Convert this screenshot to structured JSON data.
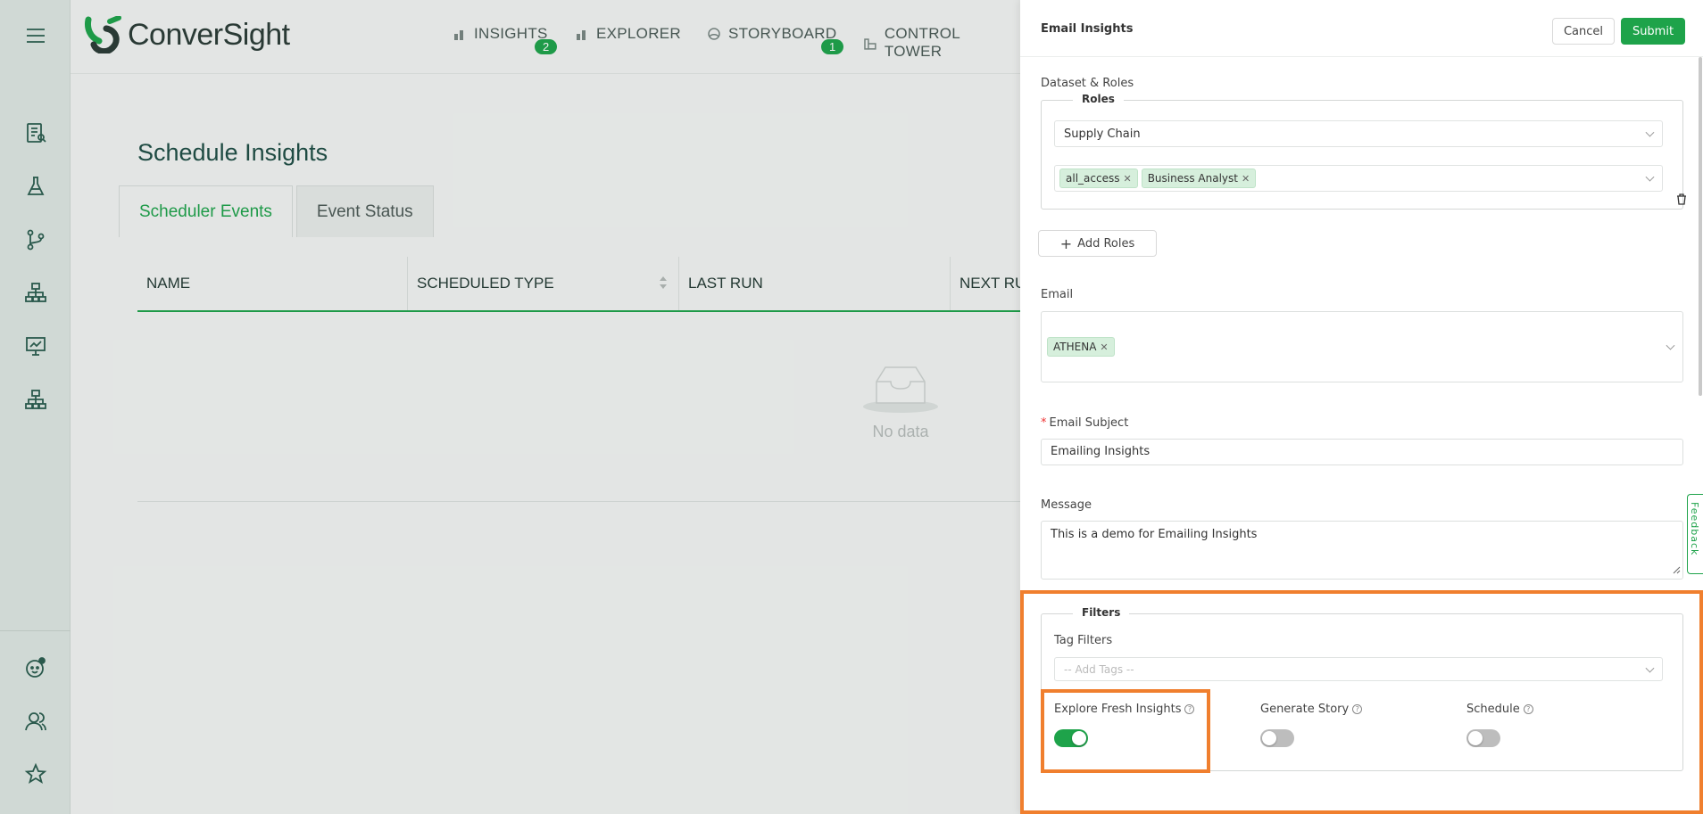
{
  "app": {
    "brand": "ConverSight"
  },
  "nav": {
    "items": [
      {
        "label": "INSIGHTS",
        "badge": "2"
      },
      {
        "label": "EXPLORER"
      },
      {
        "label": "STORYBOARD",
        "badge": "1"
      },
      {
        "label": "CONTROL TOWER"
      }
    ]
  },
  "rail": {
    "icons": [
      "menu-icon",
      "report-icon",
      "flask-icon",
      "branch-icon",
      "hierarchy-icon",
      "presentation-chart-icon",
      "org-chart-icon",
      "bot-icon",
      "users-icon",
      "star-icon"
    ]
  },
  "page": {
    "title": "Schedule Insights",
    "tabs": [
      "Scheduler Events",
      "Event Status"
    ],
    "columns": [
      "NAME",
      "SCHEDULED TYPE",
      "LAST RUN",
      "NEXT RU"
    ],
    "empty_text": "No data"
  },
  "drawer": {
    "title": "Email Insights",
    "cancel_label": "Cancel",
    "submit_label": "Submit",
    "dataset_roles_label": "Dataset & Roles",
    "roles_legend": "Roles",
    "dataset_value": "Supply Chain",
    "role_tags": [
      "all_access",
      "Business Analyst"
    ],
    "add_roles_label": "Add Roles",
    "email_label": "Email",
    "email_tags": [
      "ATHENA"
    ],
    "subject_label": "Email Subject",
    "subject_value": "Emailing Insights",
    "message_label": "Message",
    "message_value": "This is a demo for Emailing Insights",
    "filters_legend": "Filters",
    "tag_filters_label": "Tag Filters",
    "tag_filters_placeholder": "-- Add Tags --",
    "toggles": [
      {
        "label": "Explore Fresh Insights",
        "on": true
      },
      {
        "label": "Generate Story",
        "on": false
      },
      {
        "label": "Schedule",
        "on": false
      }
    ],
    "feedback_label": "Feedback"
  },
  "colors": {
    "accent": "#1ea34a",
    "highlight": "#f07f2e"
  }
}
